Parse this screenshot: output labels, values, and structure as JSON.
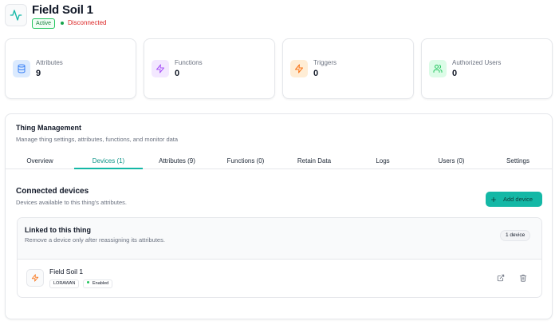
{
  "header": {
    "title": "Field Soil 1",
    "status_badge": "Active",
    "connection": "Disconnected",
    "icon": "activity-icon"
  },
  "stats": [
    {
      "label": "Attributes",
      "value": "9",
      "icon": "database-icon",
      "color": "#3b82f6",
      "bg": "#dbeafe"
    },
    {
      "label": "Functions",
      "value": "0",
      "icon": "zap-icon",
      "color": "#a855f7",
      "bg": "#f3e8ff"
    },
    {
      "label": "Triggers",
      "value": "0",
      "icon": "zap-icon",
      "color": "#f97316",
      "bg": "#ffedd5"
    },
    {
      "label": "Authorized Users",
      "value": "0",
      "icon": "users-icon",
      "color": "#22c55e",
      "bg": "#dcfce7"
    }
  ],
  "management": {
    "title": "Thing Management",
    "description": "Manage thing settings, attributes, functions, and monitor data",
    "tabs": [
      "Overview",
      "Devices (1)",
      "Attributes (9)",
      "Functions (0)",
      "Retain Data",
      "Logs",
      "Users (0)",
      "Settings"
    ],
    "active_tab": "Devices (1)"
  },
  "devices": {
    "title": "Connected devices",
    "description": "Devices available to this thing's attributes.",
    "add_label": "Add device",
    "linked": {
      "title": "Linked to this thing",
      "description": "Remove a device only after reassigning its attributes.",
      "count": "1 device",
      "items": [
        {
          "name": "Field Soil 1",
          "type": "LORAWAN",
          "status": "Enabled",
          "icon": "zap-icon"
        }
      ]
    }
  },
  "colors": {
    "accent": "#14b8a6",
    "active_green": "#22c55e",
    "disconnected_red": "#dc2626"
  }
}
